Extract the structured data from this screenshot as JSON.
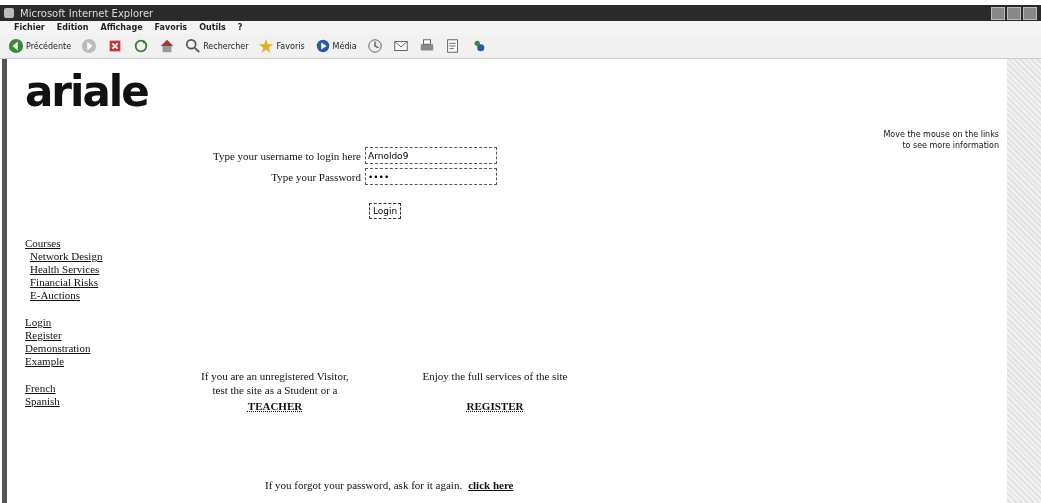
{
  "window": {
    "title": "Microsoft Internet Explorer"
  },
  "menu": [
    "Fichier",
    "Edition",
    "Affichage",
    "Favoris",
    "Outils",
    "?"
  ],
  "toolbar": [
    {
      "kind": "back",
      "label": "Précédente"
    },
    {
      "kind": "forward"
    },
    {
      "kind": "stop"
    },
    {
      "kind": "refresh"
    },
    {
      "kind": "home"
    },
    {
      "kind": "search",
      "label": "Rechercher"
    },
    {
      "kind": "favorites",
      "label": "Favoris"
    },
    {
      "kind": "media",
      "label": "Média"
    },
    {
      "kind": "history"
    },
    {
      "kind": "mail"
    },
    {
      "kind": "print"
    },
    {
      "kind": "edit"
    },
    {
      "kind": "messenger"
    }
  ],
  "logo": "ariale",
  "hint": [
    "Move the mouse on the links",
    "to see more information"
  ],
  "login": {
    "username_label": "Type your username to login here",
    "username": "Arnoldo9",
    "password_label": "Type your Password",
    "password": "••••",
    "button": "Login"
  },
  "nav_groups": [
    [
      {
        "label": "Courses",
        "children": [
          {
            "label": "Network Design"
          },
          {
            "label": "Health Services"
          },
          {
            "label": "Financial Risks"
          },
          {
            "label": "E-Auctions"
          }
        ]
      }
    ],
    [
      {
        "label": "Login"
      },
      {
        "label": "Register"
      },
      {
        "label": "Demonstration"
      },
      {
        "label": "Example"
      }
    ],
    [
      {
        "label": "French"
      },
      {
        "label": "Spanish"
      }
    ]
  ],
  "visitor": {
    "text": [
      "If you are an unregistered Visitor,",
      "test the site as a Student or a"
    ],
    "link": "TEACHER"
  },
  "member": {
    "text": [
      "Enjoy the full services of the site"
    ],
    "link": "REGISTER"
  },
  "forgot": {
    "text": "If you forgot your password, ask for it again.",
    "link": "click here"
  }
}
